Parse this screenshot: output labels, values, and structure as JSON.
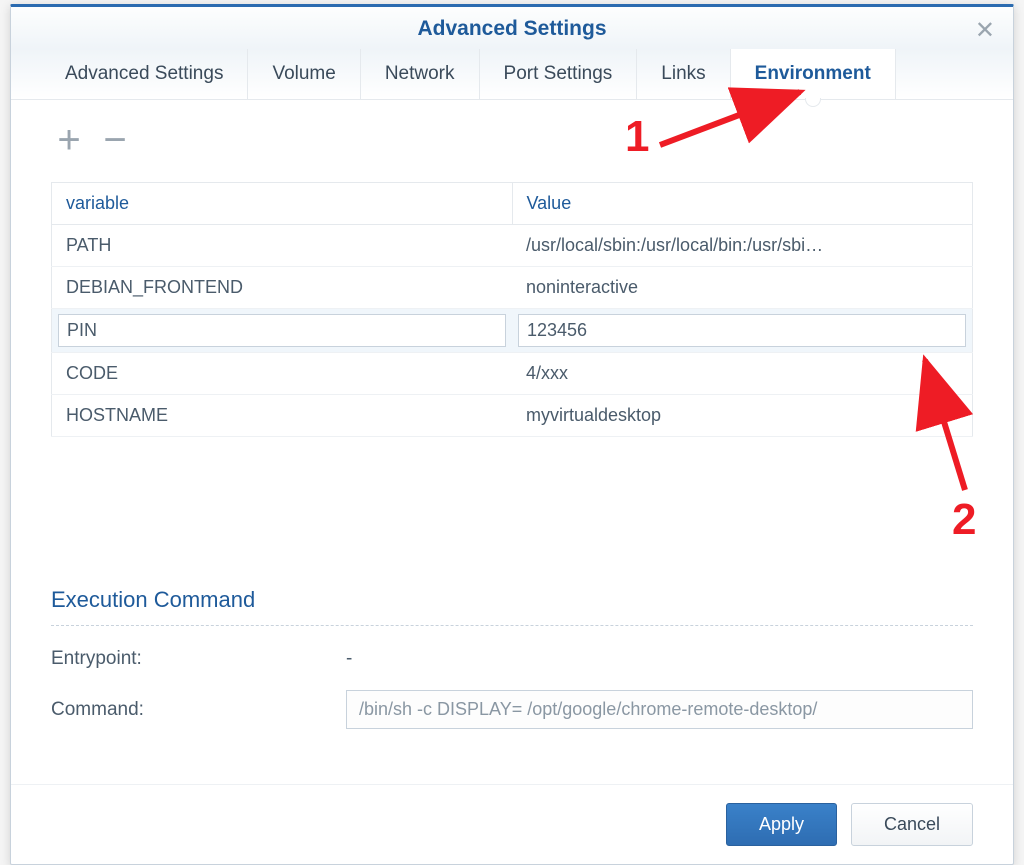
{
  "dialog": {
    "title": "Advanced Settings"
  },
  "tabs": {
    "advanced_settings": "Advanced Settings",
    "volume": "Volume",
    "network": "Network",
    "port_settings": "Port Settings",
    "links": "Links",
    "environment": "Environment"
  },
  "env_table": {
    "header_variable": "variable",
    "header_value": "Value",
    "rows": [
      {
        "variable": "PATH",
        "value": "/usr/local/sbin:/usr/local/bin:/usr/sbi…"
      },
      {
        "variable": "DEBIAN_FRONTEND",
        "value": "noninteractive"
      },
      {
        "variable": "PIN",
        "value": "123456"
      },
      {
        "variable": "CODE",
        "value": "4/xxx"
      },
      {
        "variable": "HOSTNAME",
        "value": "myvirtualdesktop"
      }
    ]
  },
  "execution": {
    "section_title": "Execution Command",
    "entrypoint_label": "Entrypoint:",
    "entrypoint_value": "-",
    "command_label": "Command:",
    "command_value": "/bin/sh -c DISPLAY= /opt/google/chrome-remote-desktop/"
  },
  "buttons": {
    "apply": "Apply",
    "cancel": "Cancel"
  },
  "annotations": {
    "label1": "1",
    "label2": "2"
  }
}
